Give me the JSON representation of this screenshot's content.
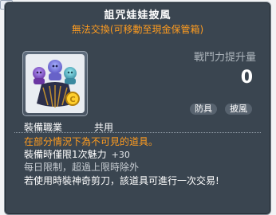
{
  "tooltip": {
    "title": "詛咒娃娃披風",
    "subtitle": "無法交換(可移動至現金保管箱)",
    "power_label": "戰鬥力提升量",
    "power_value": "0",
    "tags": [
      "防具",
      "披風"
    ],
    "job_label": "裝備職業",
    "job_value": "共用",
    "lines": {
      "warning": "在部分情況下為不可見的道具。",
      "stat_main": "裝備時僅限1次魅力",
      "stat_sub": "+30",
      "daily": "每日限制，超過上限時除外",
      "trade": "若使用時裝神奇剪刀，該道具可進行一次交易!"
    },
    "icon_name": "cursed-doll-cape-icon"
  },
  "colors": {
    "background": "#3a4550",
    "orange": "#ff9c1f",
    "white": "#ffffff"
  }
}
